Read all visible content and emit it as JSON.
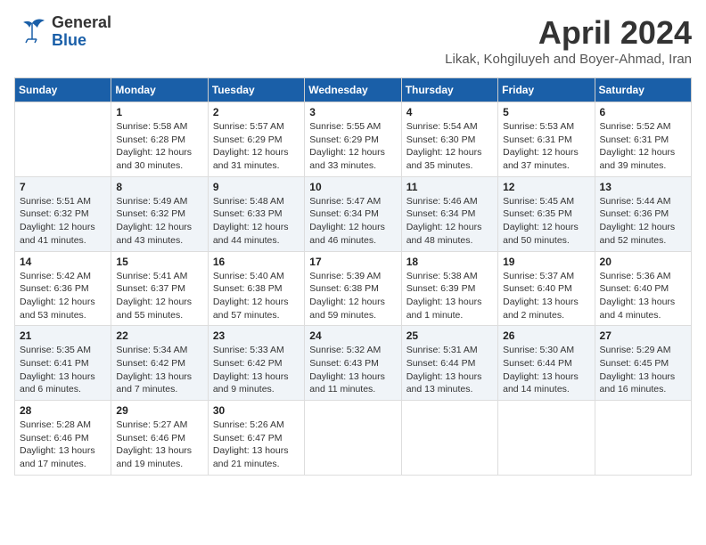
{
  "header": {
    "logo_general": "General",
    "logo_blue": "Blue",
    "month_title": "April 2024",
    "subtitle": "Likak, Kohgiluyeh and Boyer-Ahmad, Iran"
  },
  "days_of_week": [
    "Sunday",
    "Monday",
    "Tuesday",
    "Wednesday",
    "Thursday",
    "Friday",
    "Saturday"
  ],
  "weeks": [
    [
      {
        "day": "",
        "info": ""
      },
      {
        "day": "1",
        "info": "Sunrise: 5:58 AM\nSunset: 6:28 PM\nDaylight: 12 hours\nand 30 minutes."
      },
      {
        "day": "2",
        "info": "Sunrise: 5:57 AM\nSunset: 6:29 PM\nDaylight: 12 hours\nand 31 minutes."
      },
      {
        "day": "3",
        "info": "Sunrise: 5:55 AM\nSunset: 6:29 PM\nDaylight: 12 hours\nand 33 minutes."
      },
      {
        "day": "4",
        "info": "Sunrise: 5:54 AM\nSunset: 6:30 PM\nDaylight: 12 hours\nand 35 minutes."
      },
      {
        "day": "5",
        "info": "Sunrise: 5:53 AM\nSunset: 6:31 PM\nDaylight: 12 hours\nand 37 minutes."
      },
      {
        "day": "6",
        "info": "Sunrise: 5:52 AM\nSunset: 6:31 PM\nDaylight: 12 hours\nand 39 minutes."
      }
    ],
    [
      {
        "day": "7",
        "info": "Sunrise: 5:51 AM\nSunset: 6:32 PM\nDaylight: 12 hours\nand 41 minutes."
      },
      {
        "day": "8",
        "info": "Sunrise: 5:49 AM\nSunset: 6:32 PM\nDaylight: 12 hours\nand 43 minutes."
      },
      {
        "day": "9",
        "info": "Sunrise: 5:48 AM\nSunset: 6:33 PM\nDaylight: 12 hours\nand 44 minutes."
      },
      {
        "day": "10",
        "info": "Sunrise: 5:47 AM\nSunset: 6:34 PM\nDaylight: 12 hours\nand 46 minutes."
      },
      {
        "day": "11",
        "info": "Sunrise: 5:46 AM\nSunset: 6:34 PM\nDaylight: 12 hours\nand 48 minutes."
      },
      {
        "day": "12",
        "info": "Sunrise: 5:45 AM\nSunset: 6:35 PM\nDaylight: 12 hours\nand 50 minutes."
      },
      {
        "day": "13",
        "info": "Sunrise: 5:44 AM\nSunset: 6:36 PM\nDaylight: 12 hours\nand 52 minutes."
      }
    ],
    [
      {
        "day": "14",
        "info": "Sunrise: 5:42 AM\nSunset: 6:36 PM\nDaylight: 12 hours\nand 53 minutes."
      },
      {
        "day": "15",
        "info": "Sunrise: 5:41 AM\nSunset: 6:37 PM\nDaylight: 12 hours\nand 55 minutes."
      },
      {
        "day": "16",
        "info": "Sunrise: 5:40 AM\nSunset: 6:38 PM\nDaylight: 12 hours\nand 57 minutes."
      },
      {
        "day": "17",
        "info": "Sunrise: 5:39 AM\nSunset: 6:38 PM\nDaylight: 12 hours\nand 59 minutes."
      },
      {
        "day": "18",
        "info": "Sunrise: 5:38 AM\nSunset: 6:39 PM\nDaylight: 13 hours\nand 1 minute."
      },
      {
        "day": "19",
        "info": "Sunrise: 5:37 AM\nSunset: 6:40 PM\nDaylight: 13 hours\nand 2 minutes."
      },
      {
        "day": "20",
        "info": "Sunrise: 5:36 AM\nSunset: 6:40 PM\nDaylight: 13 hours\nand 4 minutes."
      }
    ],
    [
      {
        "day": "21",
        "info": "Sunrise: 5:35 AM\nSunset: 6:41 PM\nDaylight: 13 hours\nand 6 minutes."
      },
      {
        "day": "22",
        "info": "Sunrise: 5:34 AM\nSunset: 6:42 PM\nDaylight: 13 hours\nand 7 minutes."
      },
      {
        "day": "23",
        "info": "Sunrise: 5:33 AM\nSunset: 6:42 PM\nDaylight: 13 hours\nand 9 minutes."
      },
      {
        "day": "24",
        "info": "Sunrise: 5:32 AM\nSunset: 6:43 PM\nDaylight: 13 hours\nand 11 minutes."
      },
      {
        "day": "25",
        "info": "Sunrise: 5:31 AM\nSunset: 6:44 PM\nDaylight: 13 hours\nand 13 minutes."
      },
      {
        "day": "26",
        "info": "Sunrise: 5:30 AM\nSunset: 6:44 PM\nDaylight: 13 hours\nand 14 minutes."
      },
      {
        "day": "27",
        "info": "Sunrise: 5:29 AM\nSunset: 6:45 PM\nDaylight: 13 hours\nand 16 minutes."
      }
    ],
    [
      {
        "day": "28",
        "info": "Sunrise: 5:28 AM\nSunset: 6:46 PM\nDaylight: 13 hours\nand 17 minutes."
      },
      {
        "day": "29",
        "info": "Sunrise: 5:27 AM\nSunset: 6:46 PM\nDaylight: 13 hours\nand 19 minutes."
      },
      {
        "day": "30",
        "info": "Sunrise: 5:26 AM\nSunset: 6:47 PM\nDaylight: 13 hours\nand 21 minutes."
      },
      {
        "day": "",
        "info": ""
      },
      {
        "day": "",
        "info": ""
      },
      {
        "day": "",
        "info": ""
      },
      {
        "day": "",
        "info": ""
      }
    ]
  ]
}
